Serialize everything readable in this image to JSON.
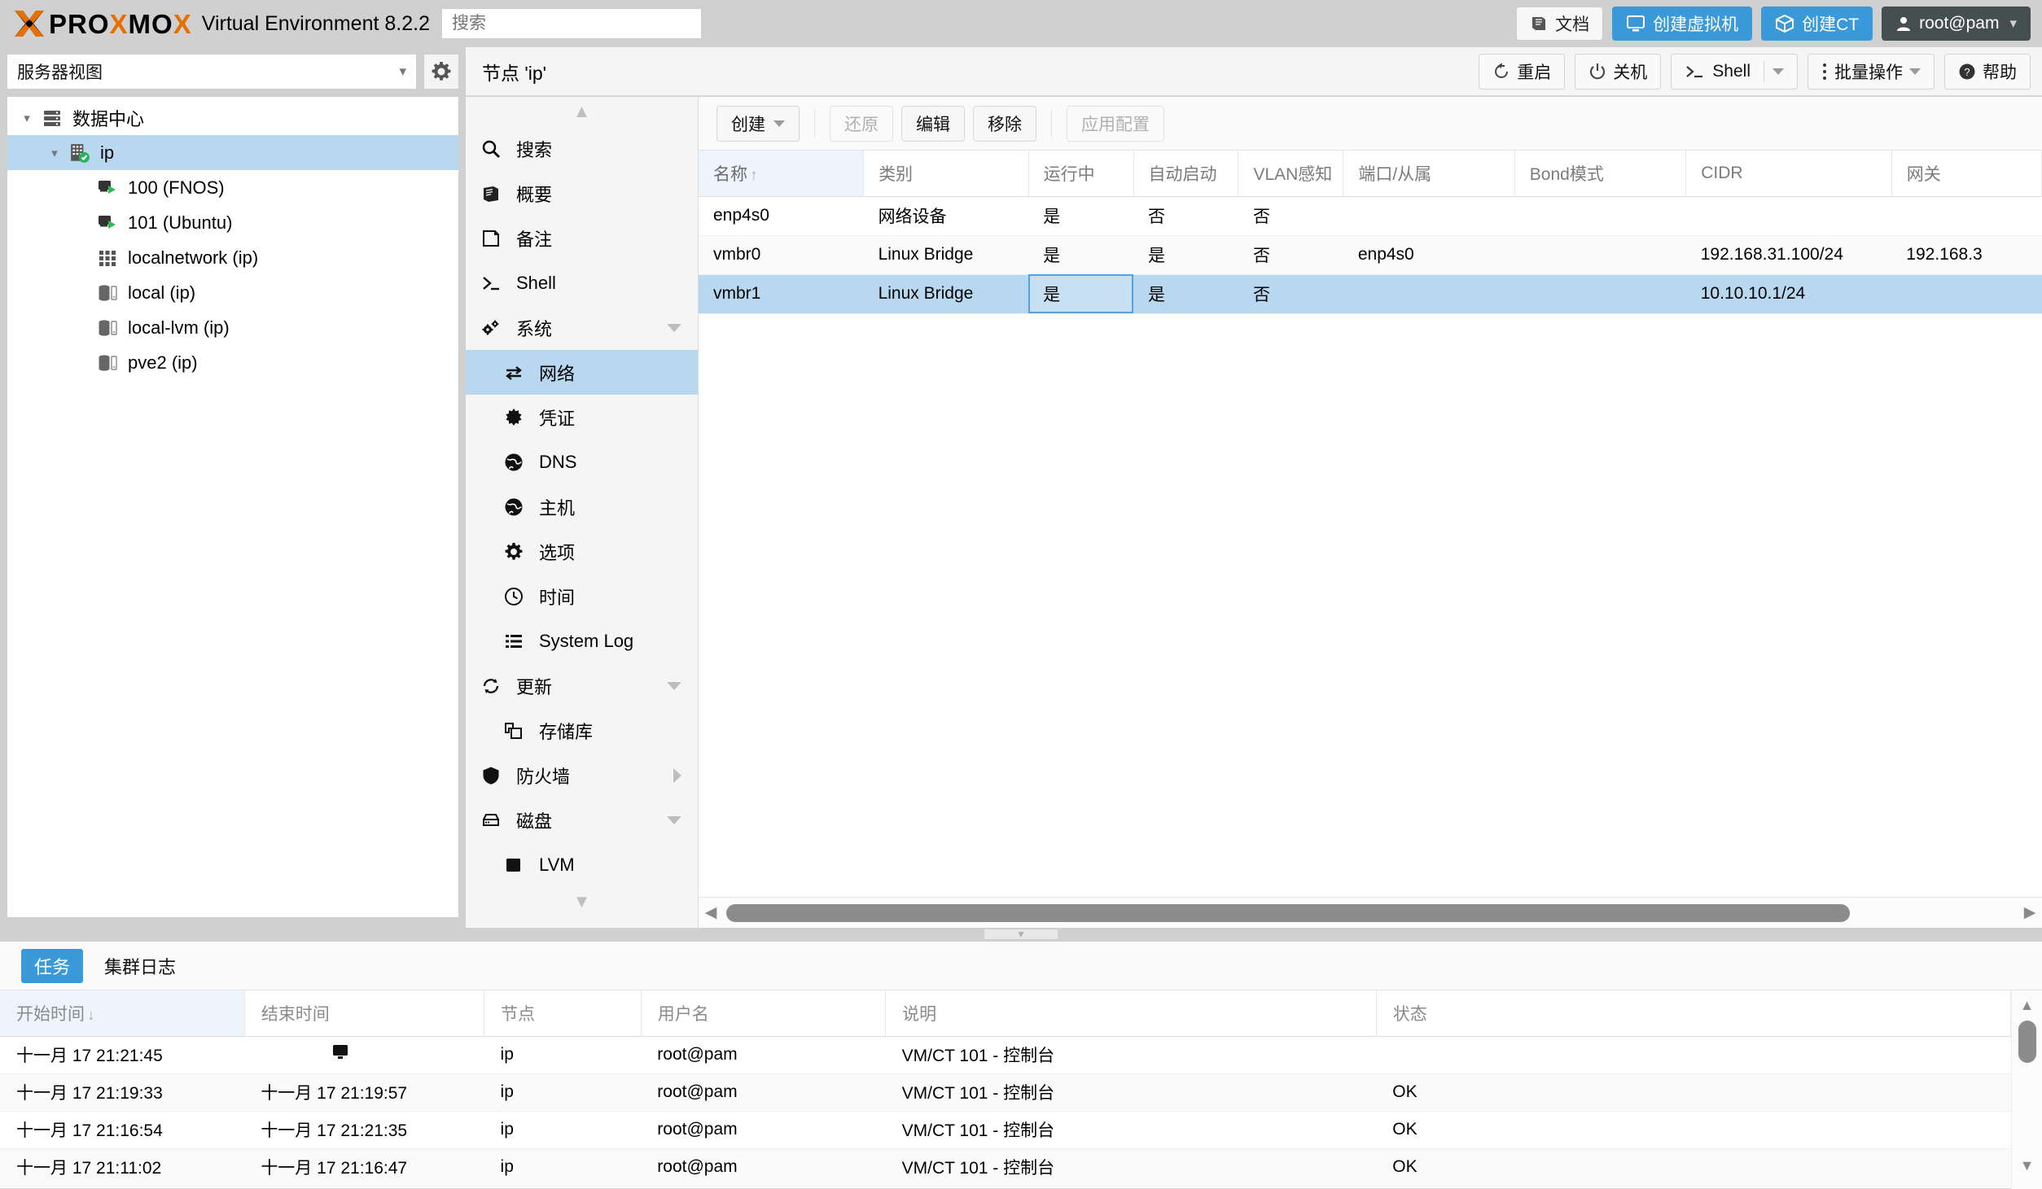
{
  "brand": {
    "logo_x": "X",
    "logo_pro": "PRO",
    "logo_x2": "X",
    "logo_mo": "MO",
    "logo_x3": "X",
    "product": "Virtual Environment 8.2.2",
    "accent_orange": "#e57000",
    "accent_blue": "#3a9ad9"
  },
  "search": {
    "placeholder": "搜索",
    "value": ""
  },
  "topbar": {
    "docs": "文档",
    "create_vm": "创建虚拟机",
    "create_ct": "创建CT",
    "user": "root@pam"
  },
  "secondbar": {
    "title": "节点 'ip'",
    "restart": "重启",
    "shutdown": "关机",
    "shell": "Shell",
    "bulk": "批量操作",
    "help": "帮助"
  },
  "leftpanel": {
    "view_selector": "服务器视图",
    "tree": [
      {
        "label": "数据中心",
        "icon": "datacenter-icon",
        "level": 0,
        "expander": "expanded",
        "selected": false
      },
      {
        "label": "ip",
        "icon": "node-icon",
        "level": 1,
        "expander": "expanded",
        "selected": true
      },
      {
        "label": "100 (FNOS)",
        "icon": "vm-running-icon",
        "level": 2,
        "expander": "none",
        "selected": false
      },
      {
        "label": "101 (Ubuntu)",
        "icon": "vm-running-icon",
        "level": 2,
        "expander": "none",
        "selected": false
      },
      {
        "label": "localnetwork (ip)",
        "icon": "network-icon",
        "level": 2,
        "expander": "none",
        "selected": false
      },
      {
        "label": "local (ip)",
        "icon": "storage-icon",
        "level": 2,
        "expander": "none",
        "selected": false
      },
      {
        "label": "local-lvm (ip)",
        "icon": "storage-icon",
        "level": 2,
        "expander": "none",
        "selected": false
      },
      {
        "label": "pve2 (ip)",
        "icon": "storage-icon",
        "level": 2,
        "expander": "none",
        "selected": false
      }
    ]
  },
  "midnav": {
    "items": [
      {
        "label": "搜索",
        "icon": "search-icon",
        "level": 0,
        "selected": false,
        "expand": "none"
      },
      {
        "label": "概要",
        "icon": "summary-book-icon",
        "level": 0,
        "selected": false,
        "expand": "none"
      },
      {
        "label": "备注",
        "icon": "note-icon",
        "level": 0,
        "selected": false,
        "expand": "none"
      },
      {
        "label": "Shell",
        "icon": "shell-prompt-icon",
        "level": 0,
        "selected": false,
        "expand": "none"
      },
      {
        "label": "系统",
        "icon": "system-gears-icon",
        "level": 0,
        "selected": false,
        "expand": "down"
      },
      {
        "label": "网络",
        "icon": "network-arrows-icon",
        "level": 1,
        "selected": true,
        "expand": "none"
      },
      {
        "label": "凭证",
        "icon": "certificate-icon",
        "level": 1,
        "selected": false,
        "expand": "none"
      },
      {
        "label": "DNS",
        "icon": "globe-icon",
        "level": 1,
        "selected": false,
        "expand": "none"
      },
      {
        "label": "主机",
        "icon": "globe-icon",
        "level": 1,
        "selected": false,
        "expand": "none"
      },
      {
        "label": "选项",
        "icon": "gear-icon",
        "level": 1,
        "selected": false,
        "expand": "none"
      },
      {
        "label": "时间",
        "icon": "clock-icon",
        "level": 1,
        "selected": false,
        "expand": "none"
      },
      {
        "label": "System Log",
        "icon": "list-icon",
        "level": 1,
        "selected": false,
        "expand": "none"
      },
      {
        "label": "更新",
        "icon": "refresh-icon",
        "level": 0,
        "selected": false,
        "expand": "down"
      },
      {
        "label": "存储库",
        "icon": "repository-icon",
        "level": 1,
        "selected": false,
        "expand": "none"
      },
      {
        "label": "防火墙",
        "icon": "shield-icon",
        "level": 0,
        "selected": false,
        "expand": "right"
      },
      {
        "label": "磁盘",
        "icon": "disk-icon",
        "level": 0,
        "selected": false,
        "expand": "down"
      },
      {
        "label": "LVM",
        "icon": "lvm-square-icon",
        "level": 1,
        "selected": false,
        "expand": "none"
      }
    ]
  },
  "main": {
    "toolbar": {
      "create": "创建",
      "revert": "还原",
      "edit": "编辑",
      "remove": "移除",
      "apply": "应用配置"
    },
    "columns": [
      {
        "label": "名称",
        "sorted": true,
        "sort_dir": "↑"
      },
      {
        "label": "类别",
        "sorted": false
      },
      {
        "label": "运行中",
        "sorted": false
      },
      {
        "label": "自动启动",
        "sorted": false
      },
      {
        "label": "VLAN感知",
        "sorted": false
      },
      {
        "label": "端口/从属",
        "sorted": false
      },
      {
        "label": "Bond模式",
        "sorted": false
      },
      {
        "label": "CIDR",
        "sorted": false
      },
      {
        "label": "网关",
        "sorted": false
      }
    ],
    "rows": [
      {
        "name": "enp4s0",
        "type": "网络设备",
        "active": "是",
        "autostart": "否",
        "vlan": "否",
        "ports": "",
        "bond": "",
        "cidr": "",
        "gateway": "",
        "selected": false,
        "alt": false
      },
      {
        "name": "vmbr0",
        "type": "Linux Bridge",
        "active": "是",
        "autostart": "是",
        "vlan": "否",
        "ports": "enp4s0",
        "bond": "",
        "cidr": "192.168.31.100/24",
        "gateway": "192.168.3",
        "selected": false,
        "alt": true
      },
      {
        "name": "vmbr1",
        "type": "Linux Bridge",
        "active": "是",
        "autostart": "是",
        "vlan": "否",
        "ports": "",
        "bond": "",
        "cidr": "10.10.10.1/24",
        "gateway": "",
        "selected": true,
        "alt": false
      }
    ]
  },
  "bottom": {
    "tabs": [
      {
        "label": "任务",
        "active": true
      },
      {
        "label": "集群日志",
        "active": false
      }
    ],
    "columns": [
      {
        "label": "开始时间",
        "sorted": true,
        "sort_dir": "↓"
      },
      {
        "label": "结束时间",
        "sorted": false
      },
      {
        "label": "节点",
        "sorted": false
      },
      {
        "label": "用户名",
        "sorted": false
      },
      {
        "label": "说明",
        "sorted": false
      },
      {
        "label": "状态",
        "sorted": false
      }
    ],
    "rows": [
      {
        "start": "十一月 17 21:21:45",
        "end": "",
        "end_icon": "monitor-icon",
        "node": "ip",
        "user": "root@pam",
        "desc": "VM/CT 101 - 控制台",
        "status": "",
        "alt": false
      },
      {
        "start": "十一月 17 21:19:33",
        "end": "十一月 17 21:19:57",
        "end_icon": "",
        "node": "ip",
        "user": "root@pam",
        "desc": "VM/CT 101 - 控制台",
        "status": "OK",
        "alt": true
      },
      {
        "start": "十一月 17 21:16:54",
        "end": "十一月 17 21:21:35",
        "end_icon": "",
        "node": "ip",
        "user": "root@pam",
        "desc": "VM/CT 101 - 控制台",
        "status": "OK",
        "alt": false
      },
      {
        "start": "十一月 17 21:11:02",
        "end": "十一月 17 21:16:47",
        "end_icon": "",
        "node": "ip",
        "user": "root@pam",
        "desc": "VM/CT 101 - 控制台",
        "status": "OK",
        "alt": true
      }
    ]
  }
}
